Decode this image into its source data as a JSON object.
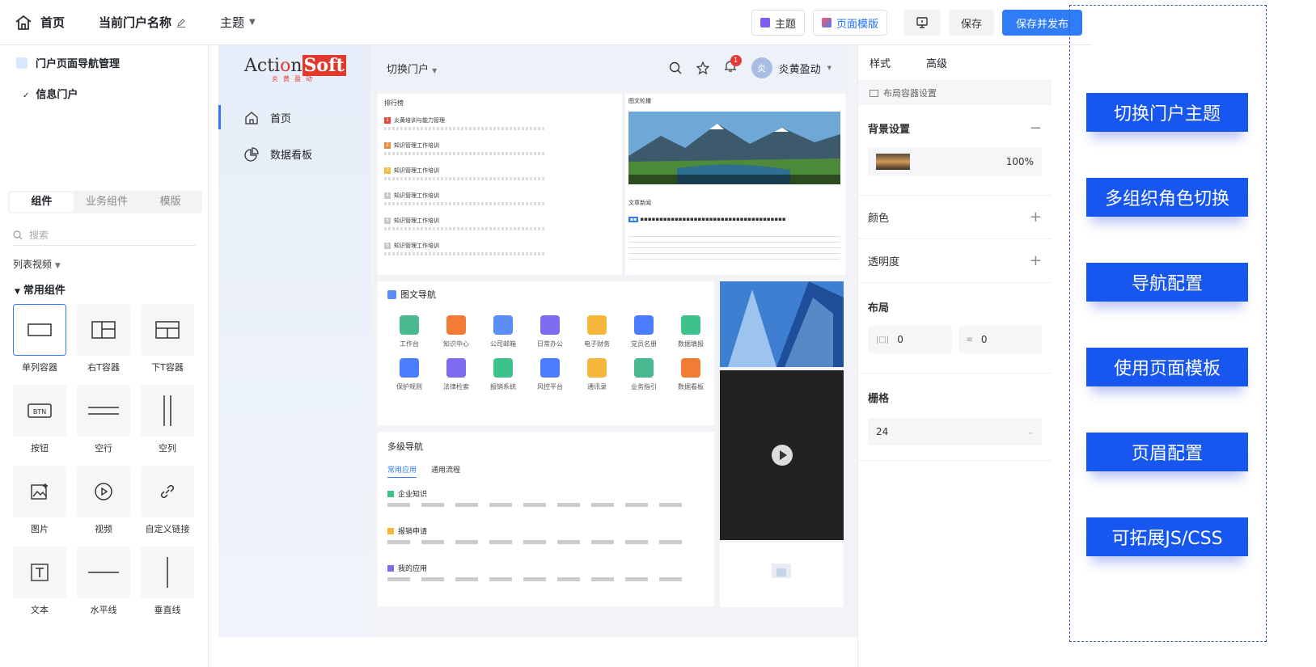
{
  "topbar": {
    "home": "首页",
    "portal_name": "当前门户名称",
    "theme": "主题",
    "theme_btn": "主题",
    "template_btn": "页面模版",
    "save": "保存",
    "save_publish": "保存并发布"
  },
  "left": {
    "nav_title": "门户页面导航管理",
    "nav_sub": "信息门户",
    "tabs": [
      "组件",
      "业务组件",
      "模版"
    ],
    "search_placeholder": "搜索",
    "list_view": "列表视频",
    "common": "常用组件",
    "components": [
      "单列容器",
      "右T容器",
      "下T容器",
      "按钮",
      "空行",
      "空列",
      "图片",
      "视频",
      "自定义链接",
      "文本",
      "水平线",
      "垂直线"
    ]
  },
  "canvas": {
    "logo_main": "ActionSoft",
    "logo_sub": "炎黄盈动",
    "side_items": [
      "首页",
      "数据看板"
    ],
    "switch_portal": "切换门户",
    "user": "炎黄盈动",
    "badge": "1",
    "avatar_char": "炎",
    "ranking_title": "排行榜",
    "ranking_rows": [
      "炎黄培训与能力管理",
      "知识管理工作培训",
      "知识管理工作培训",
      "知识管理工作培训",
      "知识管理工作培训",
      "知识管理工作培训"
    ],
    "photo_title": "图文轮播",
    "news_title": "文章新闻",
    "imgnav_title": "图文导航",
    "imgnav_items": [
      "工作台",
      "知识中心",
      "公司邮箱",
      "日常办公",
      "电子财务",
      "党员名册",
      "数据填报",
      "保护规则",
      "法律检索",
      "报销系统",
      "风控平台",
      "通讯录",
      "业务指引",
      "数据看板"
    ],
    "multinav_title": "多级导航",
    "multinav_tabs": [
      "常用应用",
      "通用流程"
    ],
    "multinav_groups": [
      "企业知识",
      "报销申请",
      "我的应用"
    ]
  },
  "right": {
    "tabs": [
      "样式",
      "高级"
    ],
    "sub": "布局容器设置",
    "bg": "背景设置",
    "bg_value": "100%",
    "color": "颜色",
    "opacity": "透明度",
    "layout": "布局",
    "layout_a": "0",
    "layout_b": "0",
    "grid": "栅格",
    "grid_value": "24"
  },
  "features": [
    "切换门户主题",
    "多组织角色切换",
    "导航配置",
    "使用页面模板",
    "页眉配置",
    "可拓展JS/CSS"
  ]
}
